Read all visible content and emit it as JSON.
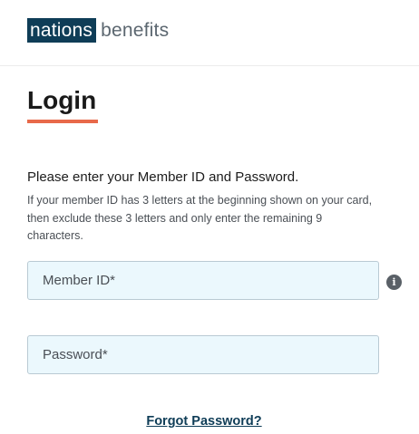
{
  "header": {
    "logo_primary": "nations",
    "logo_secondary": "benefits"
  },
  "login": {
    "title": "Login",
    "instructions": "Please enter your Member ID and Password.",
    "help_text": "If your member ID has 3 letters at the beginning shown on your card, then exclude these 3 letters and only enter the remaining 9 characters.",
    "member_id": {
      "placeholder": "Member ID*",
      "value": ""
    },
    "info_icon_glyph": "i",
    "password": {
      "placeholder": "Password*",
      "value": ""
    },
    "forgot_password_label": "Forgot Password?"
  },
  "colors": {
    "brand_navy": "#0f3d57",
    "accent_orange": "#e8694a",
    "field_background": "#ebf8fd",
    "field_border": "#b9cad3",
    "info_icon": "#5a6067"
  },
  "icons": {
    "info": "info-icon"
  }
}
